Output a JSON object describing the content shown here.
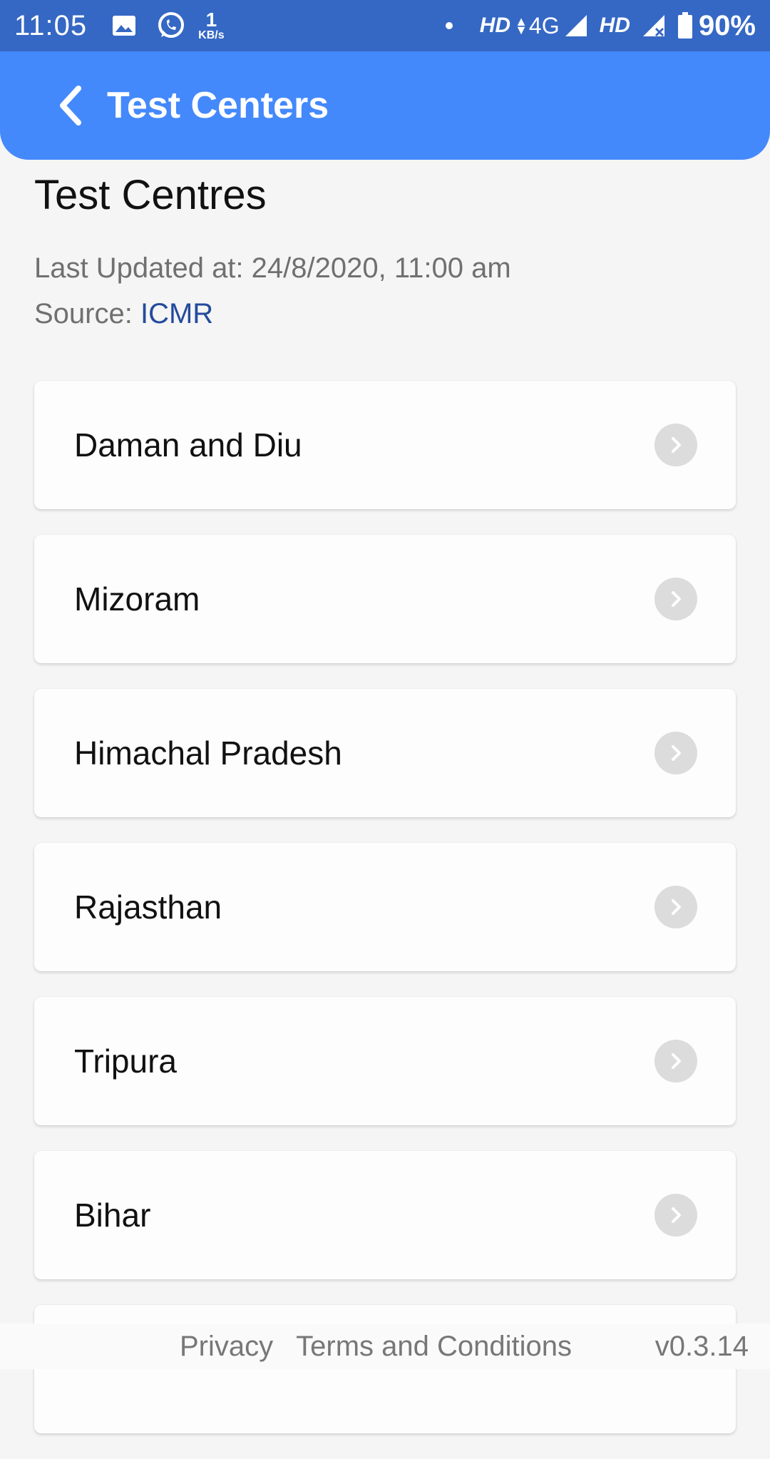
{
  "status_bar": {
    "time": "11:05",
    "net_speed_value": "1",
    "net_speed_unit": "KB/s",
    "hd1": "HD",
    "network": "4G",
    "hd2": "HD",
    "battery": "90%"
  },
  "app_bar": {
    "title": "Test Centers",
    "color": "#4489fb"
  },
  "main": {
    "heading": "Test Centres",
    "last_updated": "Last Updated at: 24/8/2020, 11:00 am",
    "source_label": "Source: ",
    "source_link": "ICMR",
    "states": [
      {
        "label": "Daman and Diu"
      },
      {
        "label": "Mizoram"
      },
      {
        "label": "Himachal Pradesh"
      },
      {
        "label": "Rajasthan"
      },
      {
        "label": "Tripura"
      },
      {
        "label": "Bihar"
      },
      {
        "label": ""
      }
    ]
  },
  "footer": {
    "privacy": "Privacy",
    "terms": "Terms and Conditions",
    "version": "v0.3.14"
  },
  "icons": {
    "back": "chevron-left-icon",
    "row": "chevron-right-icon"
  }
}
